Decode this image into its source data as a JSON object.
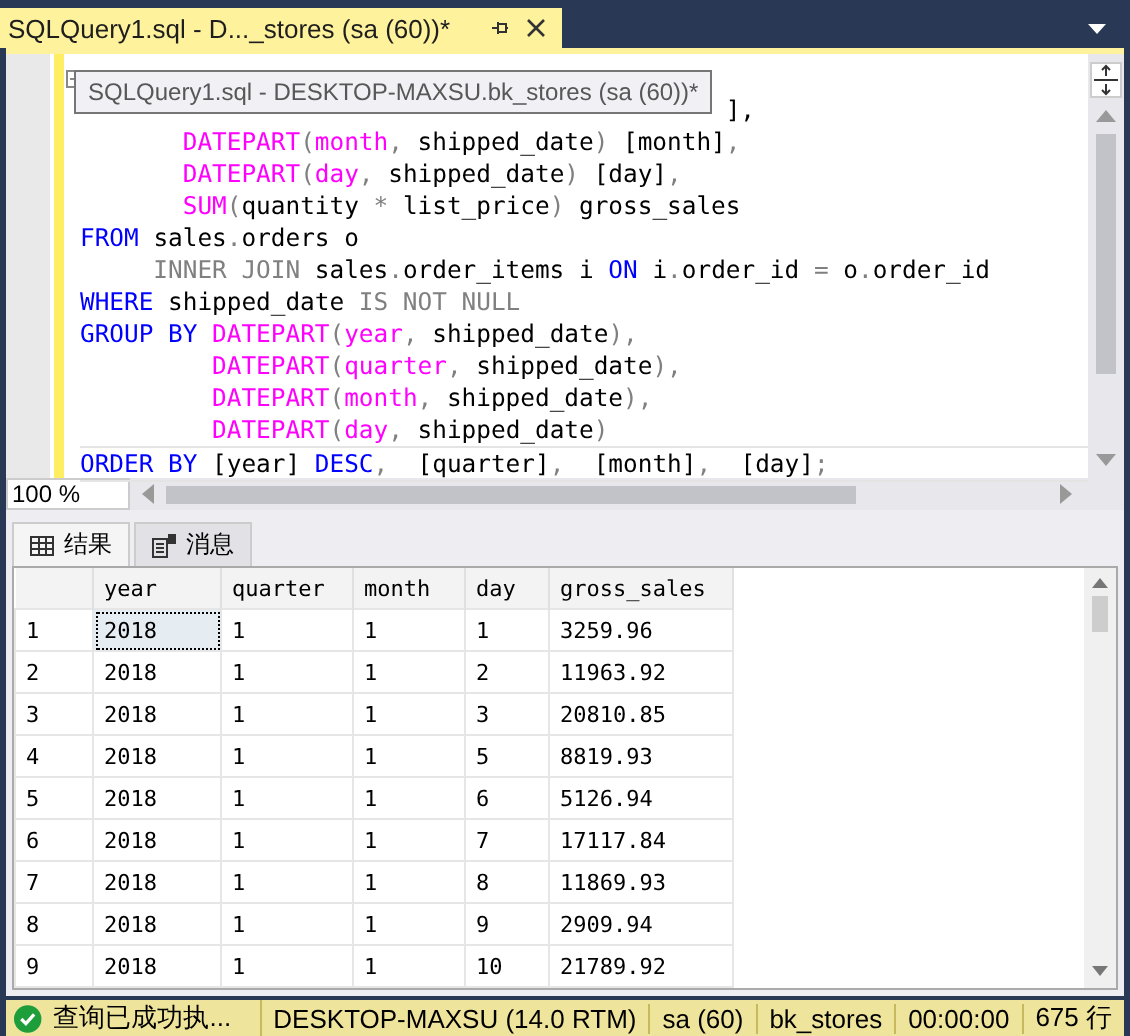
{
  "document_tab": {
    "title": "SQLQuery1.sql - D..._stores (sa (60))*",
    "selected": true
  },
  "tooltip": "SQLQuery1.sql - DESKTOP-MAXSU.bk_stores (sa (60))*",
  "editor": {
    "lines": [
      [
        {
          "text": "                                            ],",
          "kind": "plain"
        }
      ],
      [
        {
          "text": "       DATEPART",
          "kind": "fn"
        },
        {
          "text": "(",
          "kind": "op"
        },
        {
          "text": "month",
          "kind": "fn"
        },
        {
          "text": ",",
          "kind": "op"
        },
        {
          "text": " shipped_date",
          "kind": "plain"
        },
        {
          "text": ")",
          "kind": "op"
        },
        {
          "text": " [month]",
          "kind": "plain"
        },
        {
          "text": ",",
          "kind": "op"
        }
      ],
      [
        {
          "text": "       DATEPART",
          "kind": "fn"
        },
        {
          "text": "(",
          "kind": "op"
        },
        {
          "text": "day",
          "kind": "fn"
        },
        {
          "text": ",",
          "kind": "op"
        },
        {
          "text": " shipped_date",
          "kind": "plain"
        },
        {
          "text": ")",
          "kind": "op"
        },
        {
          "text": " [day]",
          "kind": "plain"
        },
        {
          "text": ",",
          "kind": "op"
        }
      ],
      [
        {
          "text": "       SUM",
          "kind": "fn"
        },
        {
          "text": "(",
          "kind": "op"
        },
        {
          "text": "quantity ",
          "kind": "plain"
        },
        {
          "text": "*",
          "kind": "op"
        },
        {
          "text": " list_price",
          "kind": "plain"
        },
        {
          "text": ")",
          "kind": "op"
        },
        {
          "text": " gross_sales",
          "kind": "plain"
        }
      ],
      [
        {
          "text": "FROM",
          "kind": "kw"
        },
        {
          "text": " sales",
          "kind": "plain"
        },
        {
          "text": ".",
          "kind": "op"
        },
        {
          "text": "orders o",
          "kind": "plain"
        }
      ],
      [
        {
          "text": "     INNER JOIN",
          "kind": "op"
        },
        {
          "text": " sales",
          "kind": "plain"
        },
        {
          "text": ".",
          "kind": "op"
        },
        {
          "text": "order_items i ",
          "kind": "plain"
        },
        {
          "text": "ON",
          "kind": "kw"
        },
        {
          "text": " i",
          "kind": "plain"
        },
        {
          "text": ".",
          "kind": "op"
        },
        {
          "text": "order_id ",
          "kind": "plain"
        },
        {
          "text": "=",
          "kind": "op"
        },
        {
          "text": " o",
          "kind": "plain"
        },
        {
          "text": ".",
          "kind": "op"
        },
        {
          "text": "order_id",
          "kind": "plain"
        }
      ],
      [
        {
          "text": "WHERE",
          "kind": "kw"
        },
        {
          "text": " shipped_date ",
          "kind": "plain"
        },
        {
          "text": "IS NOT NULL",
          "kind": "op"
        }
      ],
      [
        {
          "text": "GROUP BY",
          "kind": "kw"
        },
        {
          "text": " DATEPART",
          "kind": "fn"
        },
        {
          "text": "(",
          "kind": "op"
        },
        {
          "text": "year",
          "kind": "fn"
        },
        {
          "text": ",",
          "kind": "op"
        },
        {
          "text": " shipped_date",
          "kind": "plain"
        },
        {
          "text": "),",
          "kind": "op"
        }
      ],
      [
        {
          "text": "         DATEPART",
          "kind": "fn"
        },
        {
          "text": "(",
          "kind": "op"
        },
        {
          "text": "quarter",
          "kind": "fn"
        },
        {
          "text": ",",
          "kind": "op"
        },
        {
          "text": " shipped_date",
          "kind": "plain"
        },
        {
          "text": "),",
          "kind": "op"
        }
      ],
      [
        {
          "text": "         DATEPART",
          "kind": "fn"
        },
        {
          "text": "(",
          "kind": "op"
        },
        {
          "text": "month",
          "kind": "fn"
        },
        {
          "text": ",",
          "kind": "op"
        },
        {
          "text": " shipped_date",
          "kind": "plain"
        },
        {
          "text": "),",
          "kind": "op"
        }
      ],
      [
        {
          "text": "         DATEPART",
          "kind": "fn"
        },
        {
          "text": "(",
          "kind": "op"
        },
        {
          "text": "day",
          "kind": "fn"
        },
        {
          "text": ",",
          "kind": "op"
        },
        {
          "text": " shipped_date",
          "kind": "plain"
        },
        {
          "text": ")",
          "kind": "op"
        }
      ],
      [
        {
          "text": "ORDER BY",
          "kind": "kw"
        },
        {
          "text": " [year] ",
          "kind": "plain"
        },
        {
          "text": "DESC",
          "kind": "kw"
        },
        {
          "text": ",",
          "kind": "op"
        },
        {
          "text": "  [quarter]",
          "kind": "plain"
        },
        {
          "text": ",",
          "kind": "op"
        },
        {
          "text": "  [month]",
          "kind": "plain"
        },
        {
          "text": ",",
          "kind": "op"
        },
        {
          "text": "  [day]",
          "kind": "plain"
        },
        {
          "text": ";",
          "kind": "op"
        }
      ]
    ]
  },
  "zoom": "100 %",
  "result_tabs": [
    {
      "label": "结果",
      "selected": true
    },
    {
      "label": "消息",
      "selected": false
    }
  ],
  "table": {
    "columns": [
      "year",
      "quarter",
      "month",
      "day",
      "gross_sales"
    ],
    "rows": [
      {
        "num": "1",
        "cells": [
          "2018",
          "1",
          "1",
          "1",
          "3259.96"
        ],
        "selected": true
      },
      {
        "num": "2",
        "cells": [
          "2018",
          "1",
          "1",
          "2",
          "11963.92"
        ],
        "selected": false
      },
      {
        "num": "3",
        "cells": [
          "2018",
          "1",
          "1",
          "3",
          "20810.85"
        ],
        "selected": false
      },
      {
        "num": "4",
        "cells": [
          "2018",
          "1",
          "1",
          "5",
          "8819.93"
        ],
        "selected": false
      },
      {
        "num": "5",
        "cells": [
          "2018",
          "1",
          "1",
          "6",
          "5126.94"
        ],
        "selected": false
      },
      {
        "num": "6",
        "cells": [
          "2018",
          "1",
          "1",
          "7",
          "17117.84"
        ],
        "selected": false
      },
      {
        "num": "7",
        "cells": [
          "2018",
          "1",
          "1",
          "8",
          "11869.93"
        ],
        "selected": false
      },
      {
        "num": "8",
        "cells": [
          "2018",
          "1",
          "1",
          "9",
          "2909.94"
        ],
        "selected": false
      },
      {
        "num": "9",
        "cells": [
          "2018",
          "1",
          "1",
          "10",
          "21789.92"
        ],
        "selected": false
      }
    ]
  },
  "status_bar": {
    "message": "查询已成功执...",
    "server": "DESKTOP-MAXSU (14.0 RTM)",
    "user": "sa (60)",
    "database": "bk_stores",
    "elapsed": "00:00:00",
    "rows": "675 行"
  }
}
